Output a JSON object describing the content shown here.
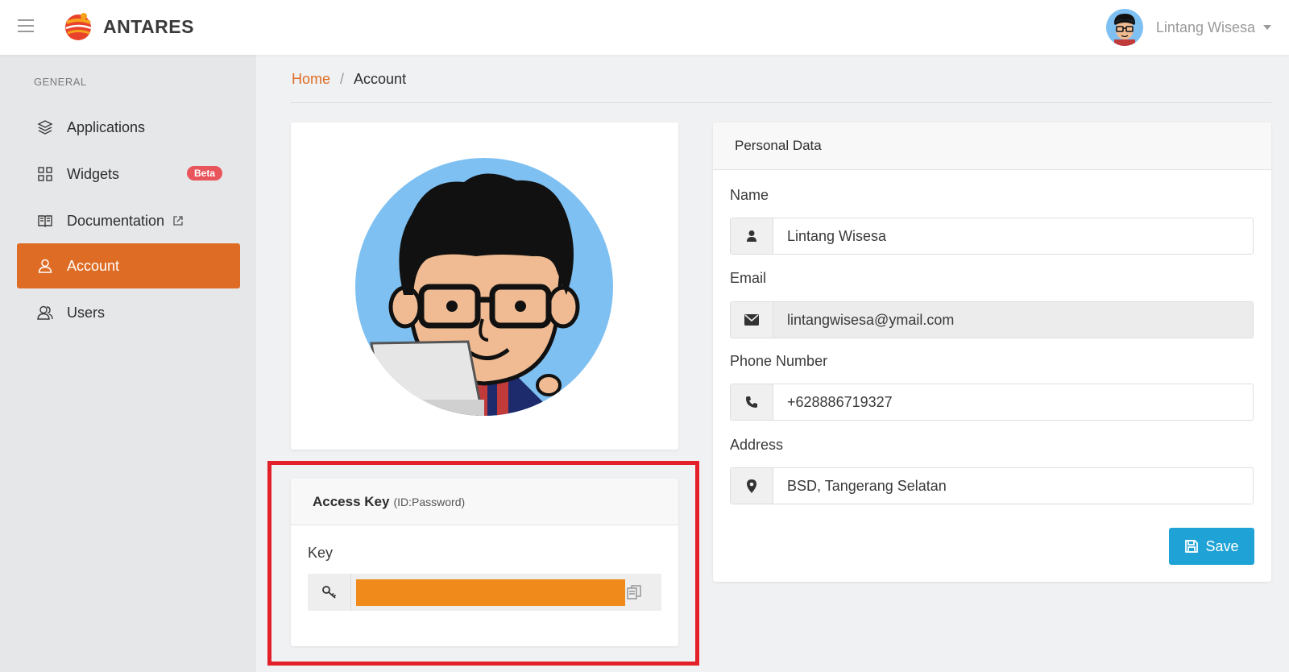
{
  "header": {
    "brand": "ANTARES",
    "user_name": "Lintang Wisesa"
  },
  "sidebar": {
    "section": "GENERAL",
    "items": [
      {
        "label": "Applications",
        "icon": "layers-icon"
      },
      {
        "label": "Widgets",
        "icon": "grid-icon",
        "badge": "Beta"
      },
      {
        "label": "Documentation",
        "icon": "book-icon",
        "external": true
      },
      {
        "label": "Account",
        "icon": "user-icon",
        "active": true
      },
      {
        "label": "Users",
        "icon": "users-icon"
      }
    ]
  },
  "breadcrumb": {
    "home": "Home",
    "separator": "/",
    "current": "Account"
  },
  "access_key": {
    "title": "Access Key",
    "subtitle": "(ID:Password)",
    "key_label": "Key"
  },
  "personal_data": {
    "title": "Personal Data",
    "fields": [
      {
        "label": "Name",
        "value": "Lintang Wisesa",
        "icon": "user-icon"
      },
      {
        "label": "Email",
        "value": "lintangwisesa@ymail.com",
        "icon": "envelope-icon",
        "readonly": true
      },
      {
        "label": "Phone Number",
        "value": "+628886719327",
        "icon": "phone-icon"
      },
      {
        "label": "Address",
        "value": "BSD, Tangerang Selatan",
        "icon": "map-marker-icon"
      }
    ],
    "save_label": "Save"
  },
  "colors": {
    "accent": "#de6c24",
    "save_button": "#1fa3d6",
    "beta_badge": "#e8555b",
    "highlight_border": "#e3202a",
    "redacted_key": "#f08a1a"
  }
}
